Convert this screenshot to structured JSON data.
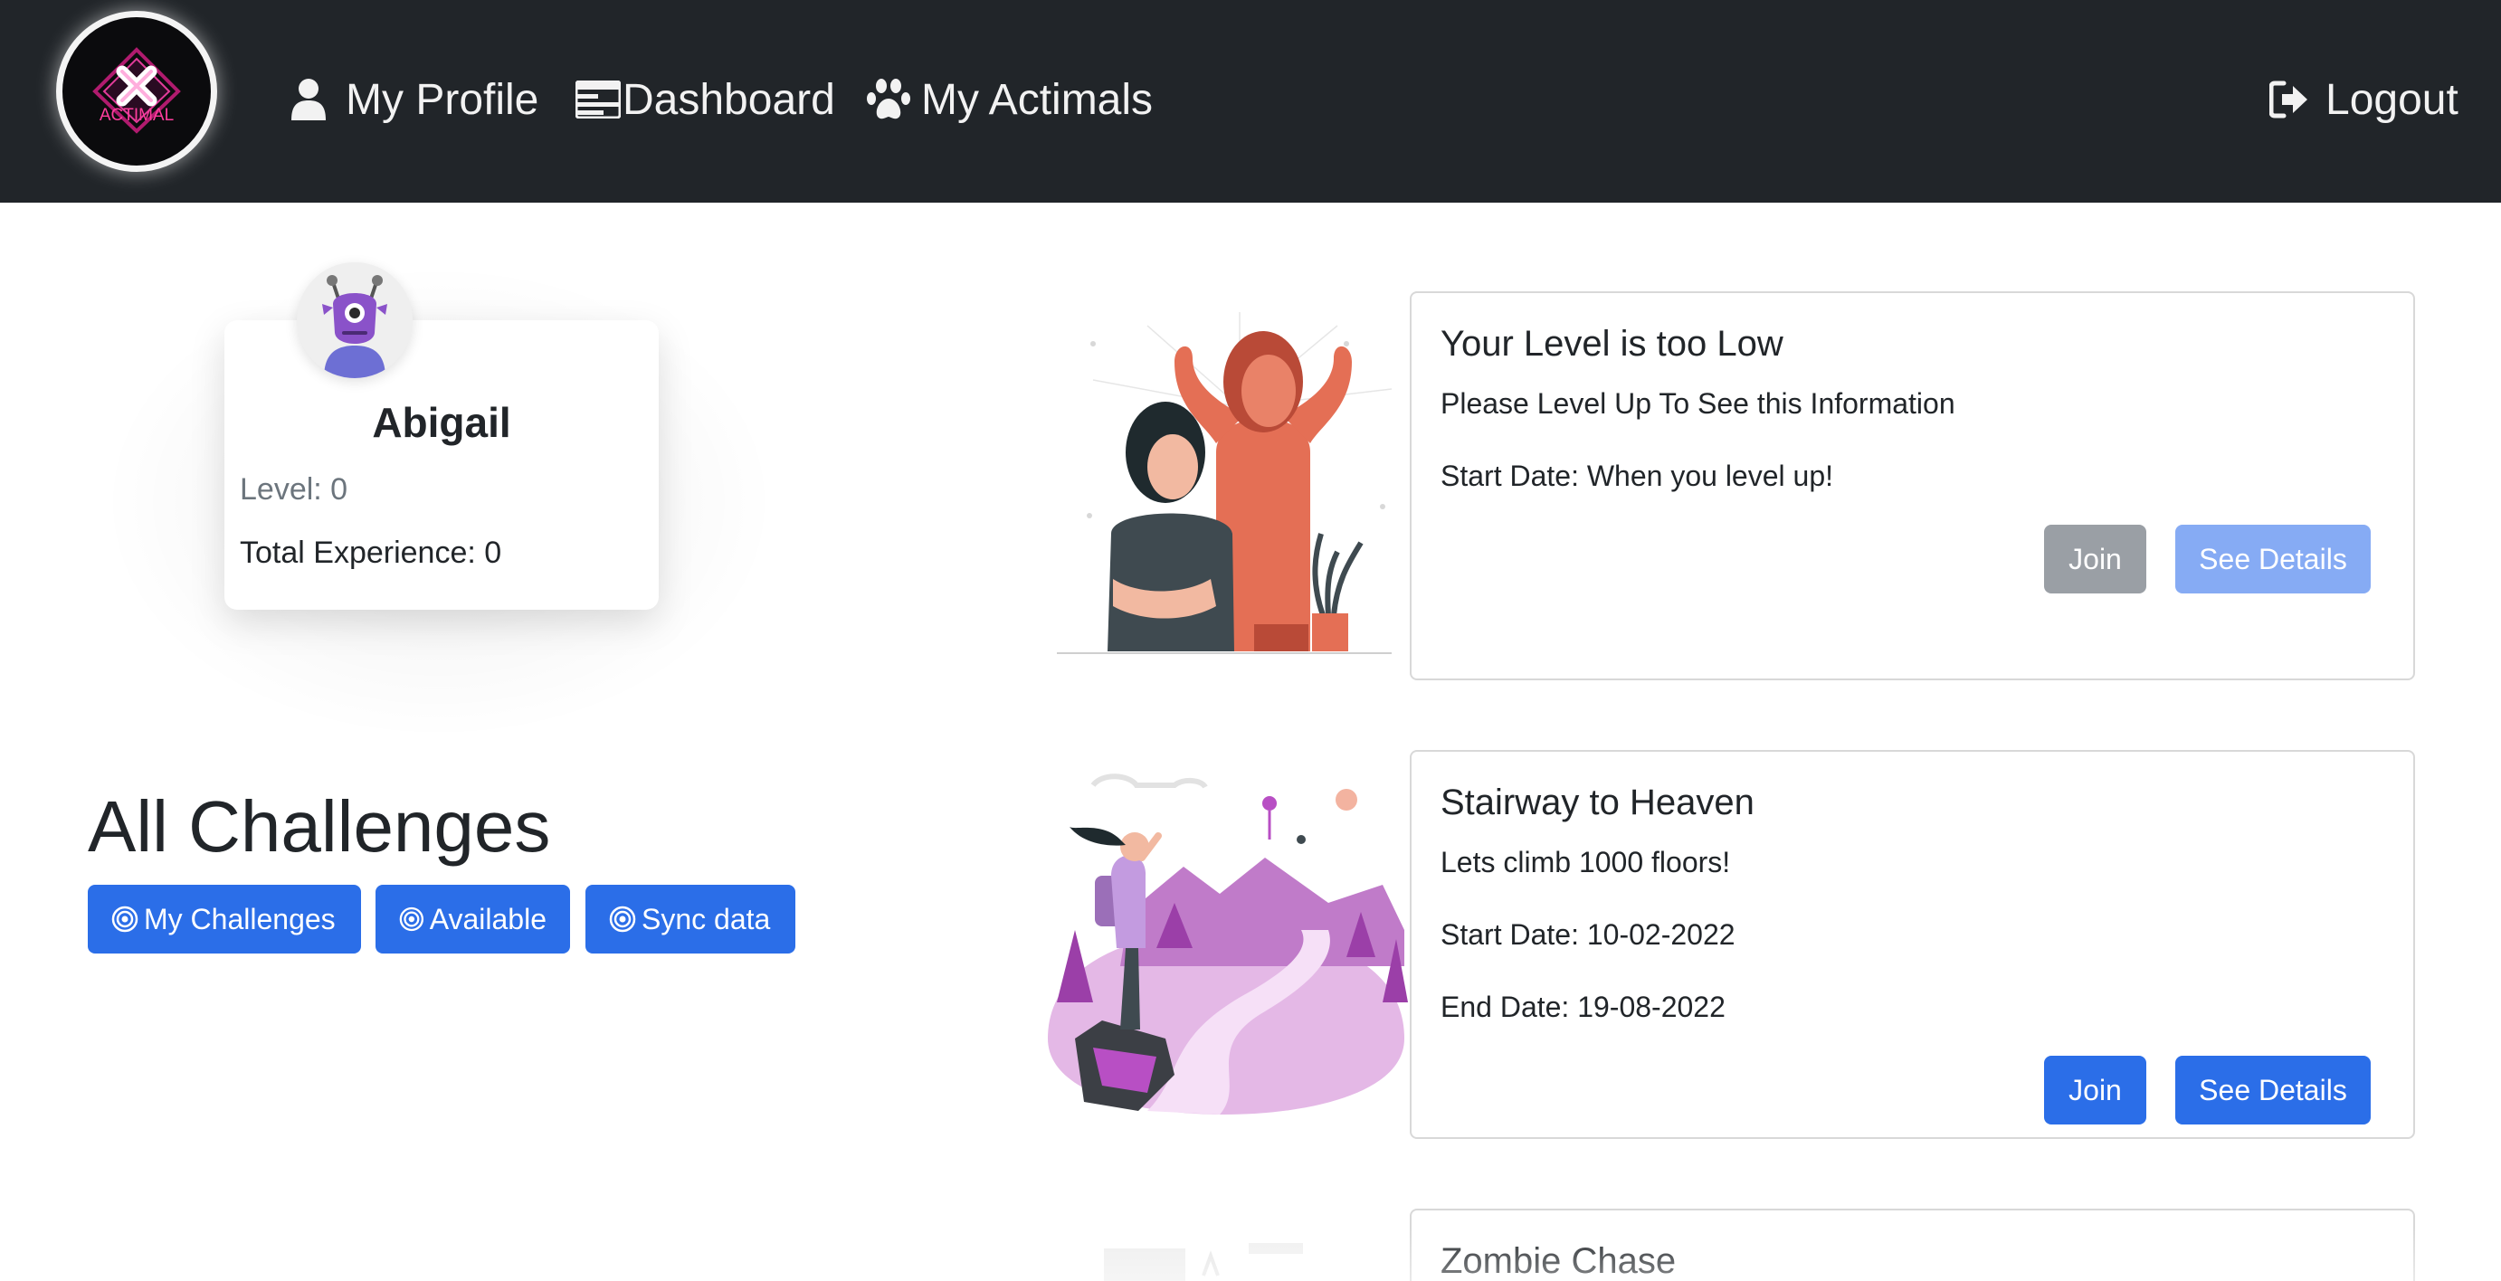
{
  "navbar": {
    "logo_text": "ACTIMAL",
    "links": [
      {
        "label": "My Profile",
        "icon": "user-icon"
      },
      {
        "label": "Dashboard",
        "icon": "dashboard-icon"
      },
      {
        "label": "My Actimals",
        "icon": "paw-icon"
      }
    ],
    "logout_label": "Logout",
    "background": "#212529"
  },
  "profile": {
    "name": "Abigail",
    "level": "Level: 0",
    "experience": "Total Experience: 0",
    "avatar_icon": "alien-avatar-icon"
  },
  "challenges": {
    "heading": "All Challenges",
    "filters": [
      "My Challenges",
      "Available",
      "Sync data"
    ],
    "items": [
      {
        "title": "Your Level is too Low",
        "description": "Please Level Up To See this Information",
        "start": "Start Date: When you level up!",
        "end": "",
        "join_label": "Join",
        "details_label": "See Details",
        "disabled": true
      },
      {
        "title": "Stairway to Heaven",
        "description": "Lets climb 1000 floors!",
        "start": "Start Date: 10-02-2022",
        "end": "End Date: 19-08-2022",
        "join_label": "Join",
        "details_label": "See Details",
        "disabled": false
      },
      {
        "title": "Zombie Chase"
      }
    ]
  },
  "colors": {
    "primary": "#2b6ee8",
    "primary_disabled": "#86abf4",
    "secondary_disabled": "#9a9fa5",
    "dark": "#212529"
  }
}
